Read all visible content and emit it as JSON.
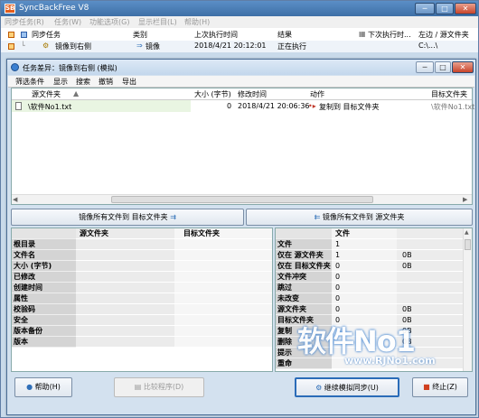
{
  "app": {
    "title": "SyncBackFree V8",
    "logo_glyph": "SB",
    "window_buttons": [
      "─",
      "□",
      "✕"
    ]
  },
  "menubar": [
    "同步任务(R)",
    "任务(W)",
    "功能选项(G)",
    "显示栏目(L)",
    "帮助(H)"
  ],
  "profiles": {
    "header": {
      "name": "同步任务",
      "type": "类别",
      "last_run": "上次执行时间",
      "result": "结果",
      "next_run": "下次执行时...",
      "left_source": "左边 / 源文件夹"
    },
    "row": {
      "name": "镜像到右侧",
      "type": "镜像",
      "last_run": "2018/4/21 20:12:01",
      "result": "正在执行",
      "next_run": "",
      "left_source": "C:\\...\\"
    }
  },
  "dialog": {
    "title": "任务差异：镜像到右侧 (模拟)",
    "menu": [
      "筛选条件",
      "显示",
      "搜索",
      "撤销",
      "导出"
    ],
    "list_headers": {
      "source": "源文件夹",
      "size": "大小 (字节)",
      "modified": "修改时间",
      "action": "动作",
      "target": "目标文件夹"
    },
    "list_row": {
      "source": "\\软件No1.txt",
      "size": "0",
      "modified": "2018/4/21 20:06:36",
      "action": "复制到 目标文件夹",
      "target": "\\软件No1.txt"
    },
    "mirror_to_target_label": "镜像所有文件到 目标文件夹",
    "mirror_to_source_label": "镜像所有文件到 源文件夹",
    "compare_left": {
      "col_source": "源文件夹",
      "col_target": "目标文件夹",
      "rows": [
        "根目录",
        "文件名",
        "大小 (字节)",
        "已修改",
        "创建时间",
        "属性",
        "校验码",
        "安全",
        "版本备份",
        "版本"
      ]
    },
    "compare_right": {
      "col_header": "文件",
      "rows": [
        {
          "label": "文件",
          "v1": "1",
          "v2": ""
        },
        {
          "label": "仅在 源文件夹",
          "v1": "1",
          "v2": "0B"
        },
        {
          "label": "仅在 目标文件夹",
          "v1": "0",
          "v2": "0B"
        },
        {
          "label": "文件冲突",
          "v1": "0",
          "v2": ""
        },
        {
          "label": "跳过",
          "v1": "0",
          "v2": ""
        },
        {
          "label": "未改变",
          "v1": "0",
          "v2": ""
        },
        {
          "label": "源文件夹",
          "v1": "0",
          "v2": "0B"
        },
        {
          "label": "目标文件夹",
          "v1": "0",
          "v2": "0B"
        },
        {
          "label": "复制",
          "v1": "",
          "v2": "0B"
        },
        {
          "label": "删除",
          "v1": "",
          "v2": "0B"
        },
        {
          "label": "提示",
          "v1": "",
          "v2": ""
        },
        {
          "label": "重命",
          "v1": "",
          "v2": ""
        }
      ]
    },
    "buttons": {
      "help": "帮助(H)",
      "compare": "比较程序(D)",
      "continue": "继续模拟同步(U)",
      "stop": "终止(Z)"
    }
  },
  "watermark": {
    "text": "软件No1",
    "url": "www.RJNo1.com"
  }
}
